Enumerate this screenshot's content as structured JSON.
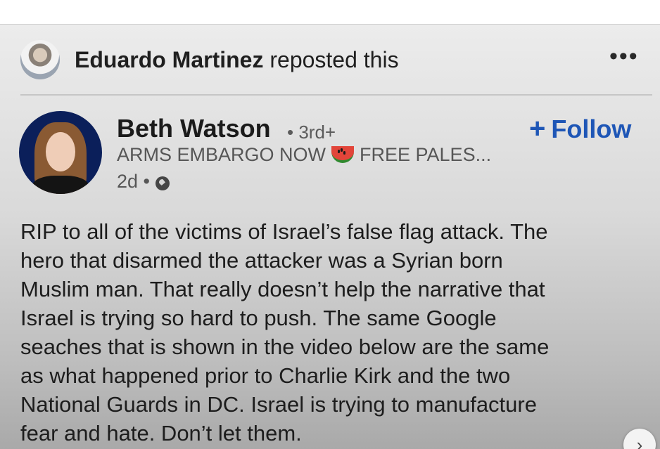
{
  "repost": {
    "name": "Eduardo Martinez",
    "action": "reposted this",
    "menu_icon": "ellipsis-icon",
    "menu_label": "•••"
  },
  "post": {
    "author": "Beth Watson",
    "degree": "• 3rd+",
    "follow_label": "Follow",
    "follow_plus": "+",
    "headline_part1": "ARMS EMBARGO NOW",
    "headline_icon": "watermelon-icon",
    "headline_part2": "FREE PALES...",
    "time": "2d •",
    "visibility_icon": "globe-icon",
    "lines": [
      "RIP to all of the victims of Israel’s false flag attack. The",
      "hero that disarmed the attacker was a Syrian born",
      "Muslim man. That really doesn’t help the narrative that",
      "Israel is trying so hard to push. The same Google",
      "seaches that is shown in the video below are the same",
      "as what happened prior to Charlie Kirk and the two",
      "National Guards in DC. Israel is trying to manufacture",
      "fear and hate. Don’t let them."
    ]
  },
  "scroll_icon": "chevron-right-icon",
  "scroll_glyph": "›",
  "colors": {
    "follow": "#1e56b6",
    "text": "#1d1d1d",
    "muted": "#565656"
  }
}
